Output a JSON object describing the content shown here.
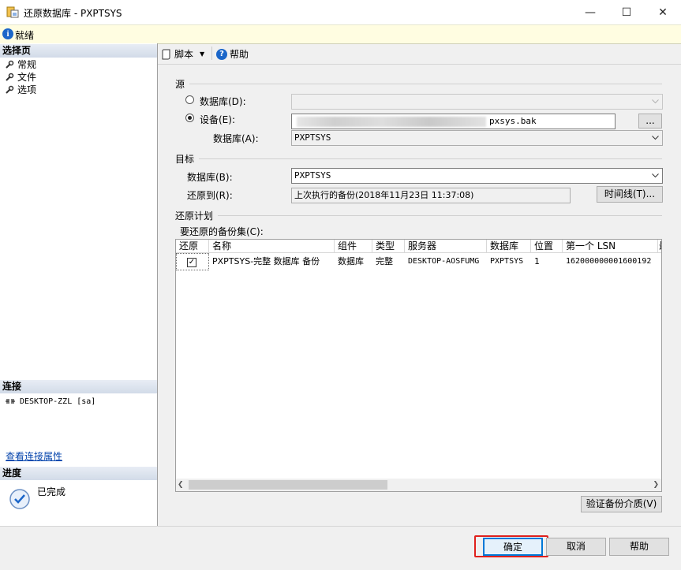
{
  "window": {
    "title": "还原数据库 - PXPTSYS",
    "minimize_glyph": "—",
    "maximize_glyph": "☐",
    "close_glyph": "✕"
  },
  "status": {
    "text": "就绪",
    "icon": "info-icon"
  },
  "left": {
    "select_page_header": "选择页",
    "pages": [
      {
        "label": "常规",
        "icon": "wrench-icon"
      },
      {
        "label": "文件",
        "icon": "wrench-icon"
      },
      {
        "label": "选项",
        "icon": "wrench-icon"
      }
    ],
    "connection_header": "连接",
    "connection_value": "DESKTOP-ZZL [sa]",
    "view_connection_link": "查看连接属性",
    "progress_header": "进度",
    "progress_status": "已完成"
  },
  "toolbar": {
    "script_label": "脚本",
    "help_label": "帮助"
  },
  "source": {
    "group_label": "源",
    "database_radio_label": "数据库(D):",
    "database_value": "",
    "device_radio_label": "设备(E):",
    "device_value": "pxsys.bak",
    "browse_label": "...",
    "device_database_label": "数据库(A):",
    "device_database_value": "PXPTSYS",
    "selected": "device"
  },
  "destination": {
    "group_label": "目标",
    "database_label": "数据库(B):",
    "database_value": "PXPTSYS",
    "restore_to_label": "还原到(R):",
    "restore_to_value": "上次执行的备份(2018年11月23日 11:37:08)",
    "timeline_button": "时间线(T)..."
  },
  "plan": {
    "group_label": "还原计划",
    "backup_sets_label": "要还原的备份集(C):",
    "columns": [
      "还原",
      "名称",
      "组件",
      "类型",
      "服务器",
      "数据库",
      "位置",
      "第一个 LSN",
      "最"
    ],
    "rows": [
      {
        "restore": true,
        "name": "PXPTSYS-完整 数据库 备份",
        "component": "数据库",
        "type": "完整",
        "server": "DESKTOP-AOSFUMG",
        "database": "PXPTSYS",
        "position": "1",
        "first_lsn": "162000000001600192"
      }
    ],
    "verify_button": "验证备份介质(V)"
  },
  "buttons": {
    "ok": "确定",
    "cancel": "取消",
    "help": "帮助"
  },
  "colors": {
    "status_bg": "#fffde1",
    "section_header_bg": "#d2dbe8",
    "link": "#0645ad",
    "ok_highlight": "#e0201c",
    "ok_focus": "#0078d7"
  }
}
